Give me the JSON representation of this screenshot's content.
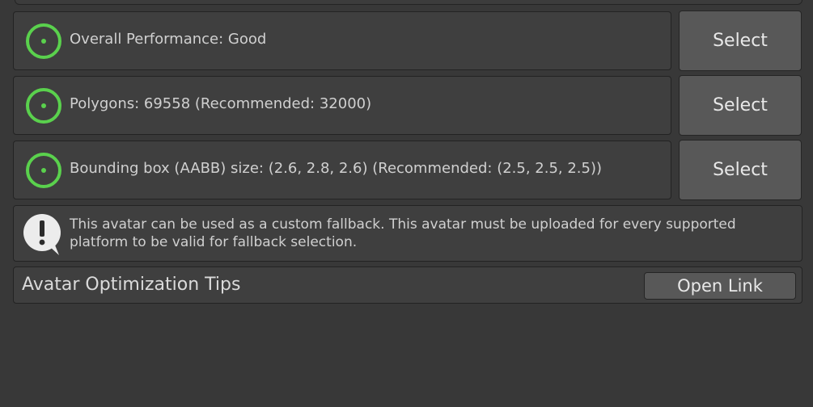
{
  "performance": {
    "items": [
      {
        "text": "Overall Performance: Good",
        "status": "good",
        "button_label": "Select"
      },
      {
        "text": "Polygons: 69558 (Recommended: 32000)",
        "status": "good",
        "button_label": "Select"
      },
      {
        "text": "Bounding box (AABB) size: (2.6, 2.8, 2.6) (Recommended: (2.5, 2.5, 2.5))",
        "status": "good",
        "button_label": "Select"
      }
    ]
  },
  "fallback_notice": {
    "icon": "warning-speech-bubble-icon",
    "text": "This avatar can be used as a custom fallback. This avatar must be uploaded for every supported platform to be valid for fallback selection."
  },
  "tips": {
    "label": "Avatar Optimization Tips",
    "button_label": "Open Link"
  },
  "colors": {
    "background": "#383838",
    "panel": "#3f3f3f",
    "button": "#585858",
    "status_good": "#5ad14d",
    "text": "#d0d0d0"
  }
}
